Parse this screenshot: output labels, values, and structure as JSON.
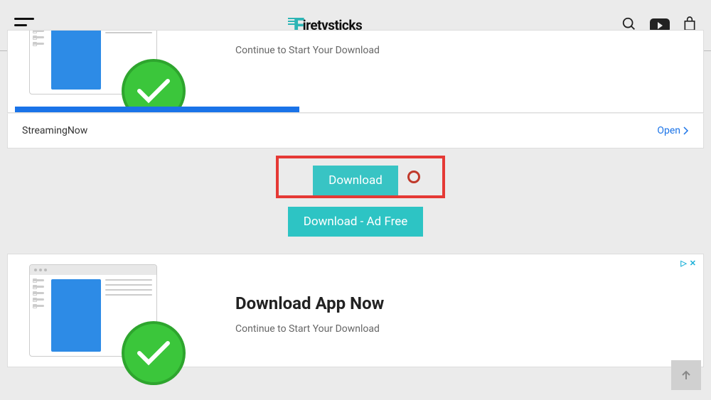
{
  "header": {
    "brand_prefix": "F",
    "brand_text": "iretvsticks"
  },
  "ad_top": {
    "subtitle": "Continue to Start Your Download",
    "name": "StreamingNow",
    "open_label": "Open"
  },
  "buttons": {
    "download": "Download",
    "adfree": "Download - Ad Free"
  },
  "ad_bottom": {
    "title": "Download App Now",
    "subtitle": "Continue to Start Your Download",
    "choices_icon": "▷",
    "close_icon": "✕"
  }
}
